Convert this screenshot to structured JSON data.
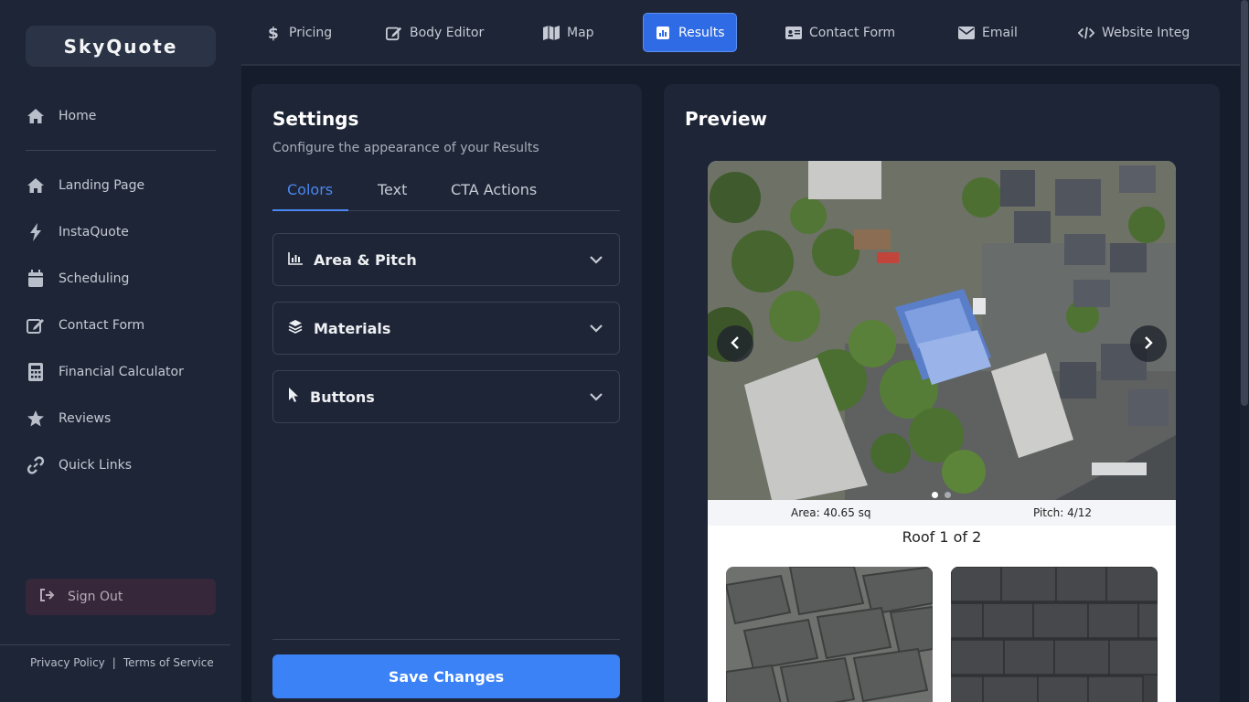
{
  "app": {
    "logo": "SkyQuote"
  },
  "sidebar": {
    "items": [
      {
        "label": "Home",
        "icon": "home-icon"
      },
      {
        "label": "Landing Page",
        "icon": "home-icon"
      },
      {
        "label": "InstaQuote",
        "icon": "bolt-icon"
      },
      {
        "label": "Scheduling",
        "icon": "calendar-icon"
      },
      {
        "label": "Contact Form",
        "icon": "edit-icon"
      },
      {
        "label": "Financial Calculator",
        "icon": "calculator-icon"
      },
      {
        "label": "Reviews",
        "icon": "star-icon"
      },
      {
        "label": "Quick Links",
        "icon": "link-icon"
      }
    ],
    "sign_out": "Sign Out",
    "footer": {
      "privacy": "Privacy Policy",
      "separator": "|",
      "terms": "Terms of Service"
    }
  },
  "topnav": {
    "tabs": [
      {
        "label": "Pricing",
        "icon": "dollar-icon"
      },
      {
        "label": "Body Editor",
        "icon": "edit-icon"
      },
      {
        "label": "Map",
        "icon": "map-icon"
      },
      {
        "label": "Results",
        "icon": "chart-icon",
        "active": true
      },
      {
        "label": "Contact Form",
        "icon": "id-card-icon"
      },
      {
        "label": "Email",
        "icon": "envelope-icon"
      },
      {
        "label": "Website Integ",
        "icon": "code-icon"
      }
    ]
  },
  "settings": {
    "title": "Settings",
    "subtitle": "Configure the appearance of your Results",
    "subtabs": [
      "Colors",
      "Text",
      "CTA Actions"
    ],
    "active_subtab": "Colors",
    "sections": [
      {
        "label": "Area & Pitch",
        "icon": "chart-icon"
      },
      {
        "label": "Materials",
        "icon": "layers-icon"
      },
      {
        "label": "Buttons",
        "icon": "pointer-icon"
      }
    ],
    "save_label": "Save Changes"
  },
  "preview": {
    "title": "Preview",
    "area": "Area: 40.65 sq",
    "pitch": "Pitch: 4/12",
    "roof_label": "Roof 1 of 2",
    "carousel_total": 2,
    "carousel_active": 1
  },
  "colors": {
    "accent": "#3b82f6",
    "active_tab": "#2f6be4",
    "sidebar_bg": "#1e2536",
    "page_bg": "#151c2b"
  }
}
